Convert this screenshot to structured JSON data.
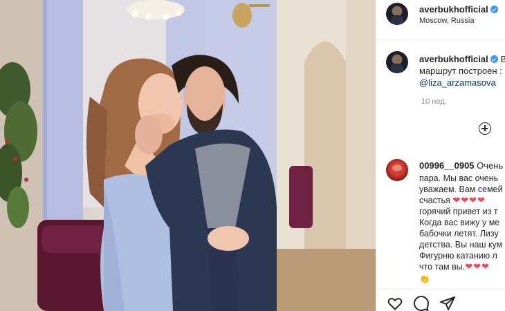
{
  "post": {
    "username": "averbukhofficial",
    "location": "Moscow, Russia",
    "more_label": "•••"
  },
  "caption": {
    "username": "averbukhofficial",
    "trail": "В",
    "line2": "маршрут построен :",
    "mention": "@liza_arzamasova",
    "time": "10 нед."
  },
  "comment": {
    "username": "00996__0905",
    "head": "Очень",
    "lines": [
      "пара. Мы вас очень",
      "уважаем. Вам семей",
      "счастья",
      "горячий привет из т",
      "Когда вас вижу у ме",
      "бабочки летят. Лизу",
      "детства. Вы наш кум",
      "Фигурню катанию л",
      "что там вы."
    ],
    "hearts_a": "❤❤❤❤",
    "hearts_b": "❤❤❤",
    "emoji": "👏"
  },
  "icons": {
    "verified": "verified-badge-icon",
    "plus": "plus-circle-icon",
    "like": "heart-outline-icon",
    "comment": "comment-bubble-icon",
    "share": "paper-plane-icon"
  },
  "colors": {
    "verified": "#3897f0",
    "mention": "#00376b",
    "heart": "#ed4956",
    "muted": "#8e8e8e"
  }
}
